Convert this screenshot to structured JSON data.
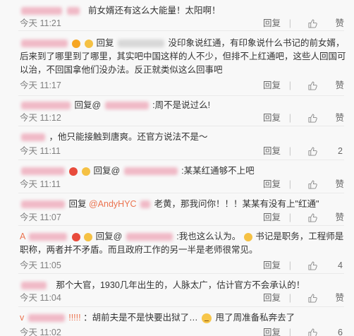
{
  "comments": [
    {
      "text": "前女婿还有这么大能量！太阳啊！",
      "time": "今天 11:21",
      "reply_label": "回复",
      "like_label": "赞"
    },
    {
      "reply_prefix": "回复",
      "text_1": "没印象说红通，有印象说什么书记的前女婿，",
      "text_2": "后来到了哪里到了哪里，其实吧中国这样的人不少，但排不上红通吧，这些人回国可",
      "text_3": "以治，不回国拿他们没办法。反正就类似这么回事吧",
      "time": "今天 11:17",
      "reply_label": "回复",
      "like_label": "赞"
    },
    {
      "reply_prefix": "回复@",
      "text": ":周不是说过么!",
      "time": "今天 11:12",
      "reply_label": "回复",
      "like_label": "赞"
    },
    {
      "text": "，他只能接触到唐爽。还官方说法不是～",
      "time": "今天 11:11",
      "reply_label": "回复",
      "like_count": "2"
    },
    {
      "reply_prefix": "回复@",
      "text": ":某某红通够不上吧",
      "time": "今天 11:11",
      "reply_label": "回复",
      "like_label": "赞"
    },
    {
      "reply_prefix": "回复",
      "mention": "@AndyHYC",
      "text": "老黄，那我问你！！！某某有没有上\"红通\"",
      "time": "今天 11:07",
      "reply_label": "回复",
      "like_label": "赞"
    },
    {
      "name_fragment": "A",
      "reply_prefix": "回复@",
      "text_1": ":我也这么认为。",
      "text_1b": "书记是职务，工程师是",
      "text_2": "职称，两者并不矛盾。而且政府工作的另一半是老师很常见。",
      "time": "今天 11:05",
      "reply_label": "回复",
      "like_count": "4"
    },
    {
      "text": "那个大官，1930几年出生的，人脉太广，估计官方不会承认的！",
      "time": "今天 11:04",
      "reply_label": "回复",
      "like_label": "赞"
    },
    {
      "name_fragment": "v",
      "name_suffix": "!!!!!",
      "text_1": "：胡前夫是不是快要出狱了…",
      "text_2": "甩了周准备私奔去了",
      "time": "今天 11:02",
      "reply_label": "回复",
      "like_count": "6"
    }
  ]
}
